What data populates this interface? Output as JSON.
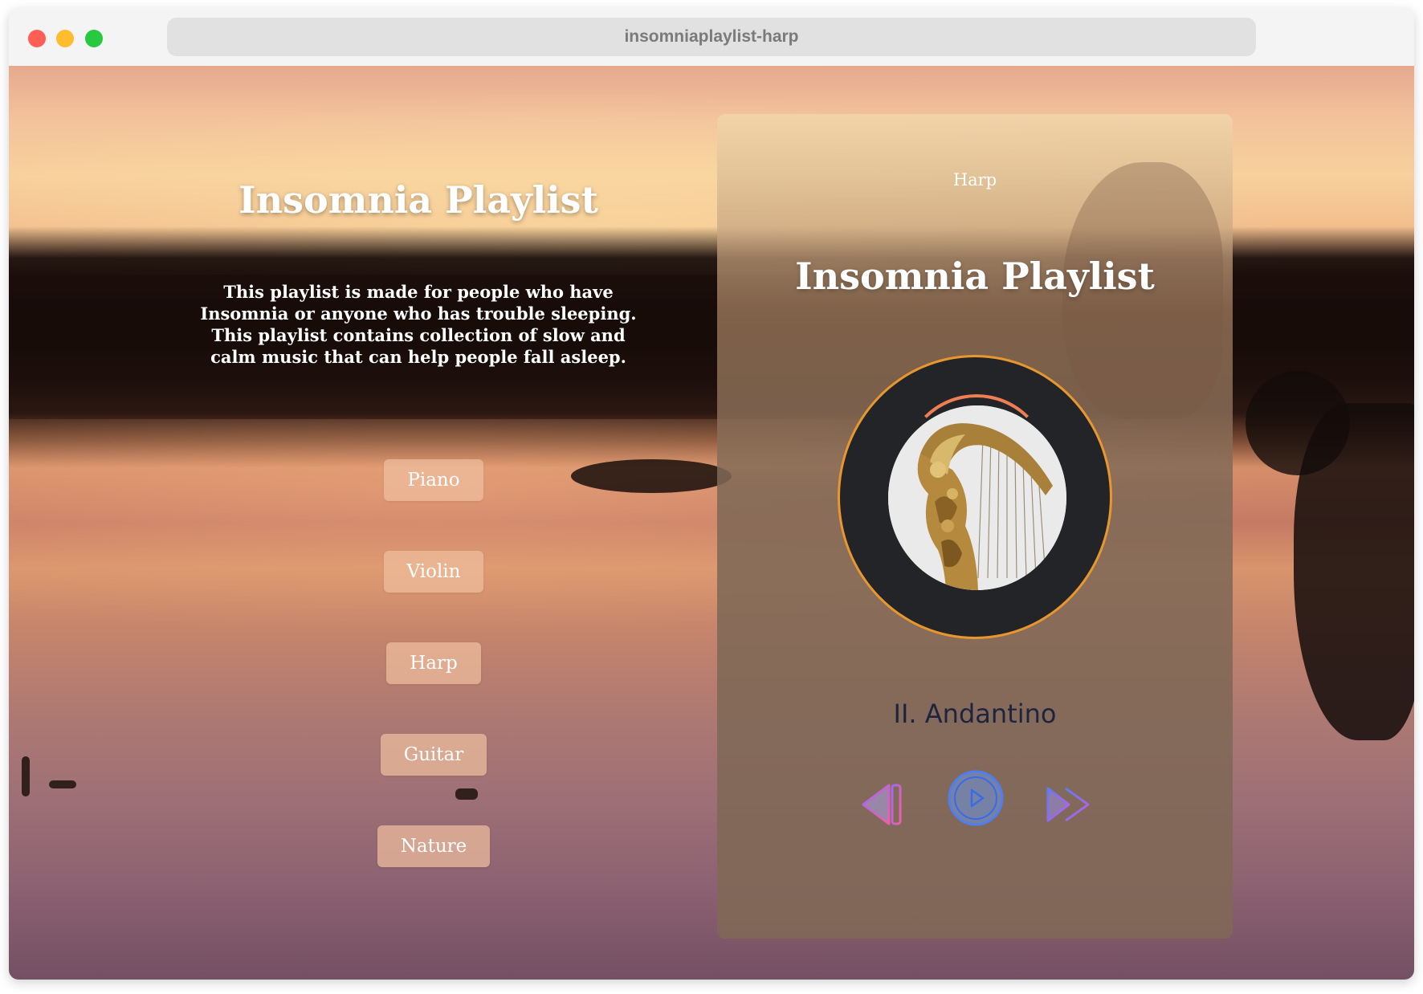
{
  "browser": {
    "url": "insomniaplaylist-harp"
  },
  "hero": {
    "title": "Insomnia Playlist",
    "description": "This playlist is made for people who have Insomnia or anyone who has trouble sleeping. This playlist contains collection of slow and calm music that can help people fall asleep."
  },
  "categories": [
    {
      "label": "Piano"
    },
    {
      "label": "Violin"
    },
    {
      "label": "Harp"
    },
    {
      "label": "Guitar"
    },
    {
      "label": "Nature"
    }
  ],
  "player": {
    "category": "Harp",
    "title": "Insomnia Playlist",
    "track": "II. Andantino",
    "controls": {
      "previous_icon": "previous-icon",
      "play_icon": "play-icon",
      "next_icon": "next-icon"
    }
  },
  "colors": {
    "disc_ring": "#e8972e",
    "disc_arc": "#ef7f52",
    "track_text": "#1e2440",
    "play_button": "#4f7ef0"
  }
}
